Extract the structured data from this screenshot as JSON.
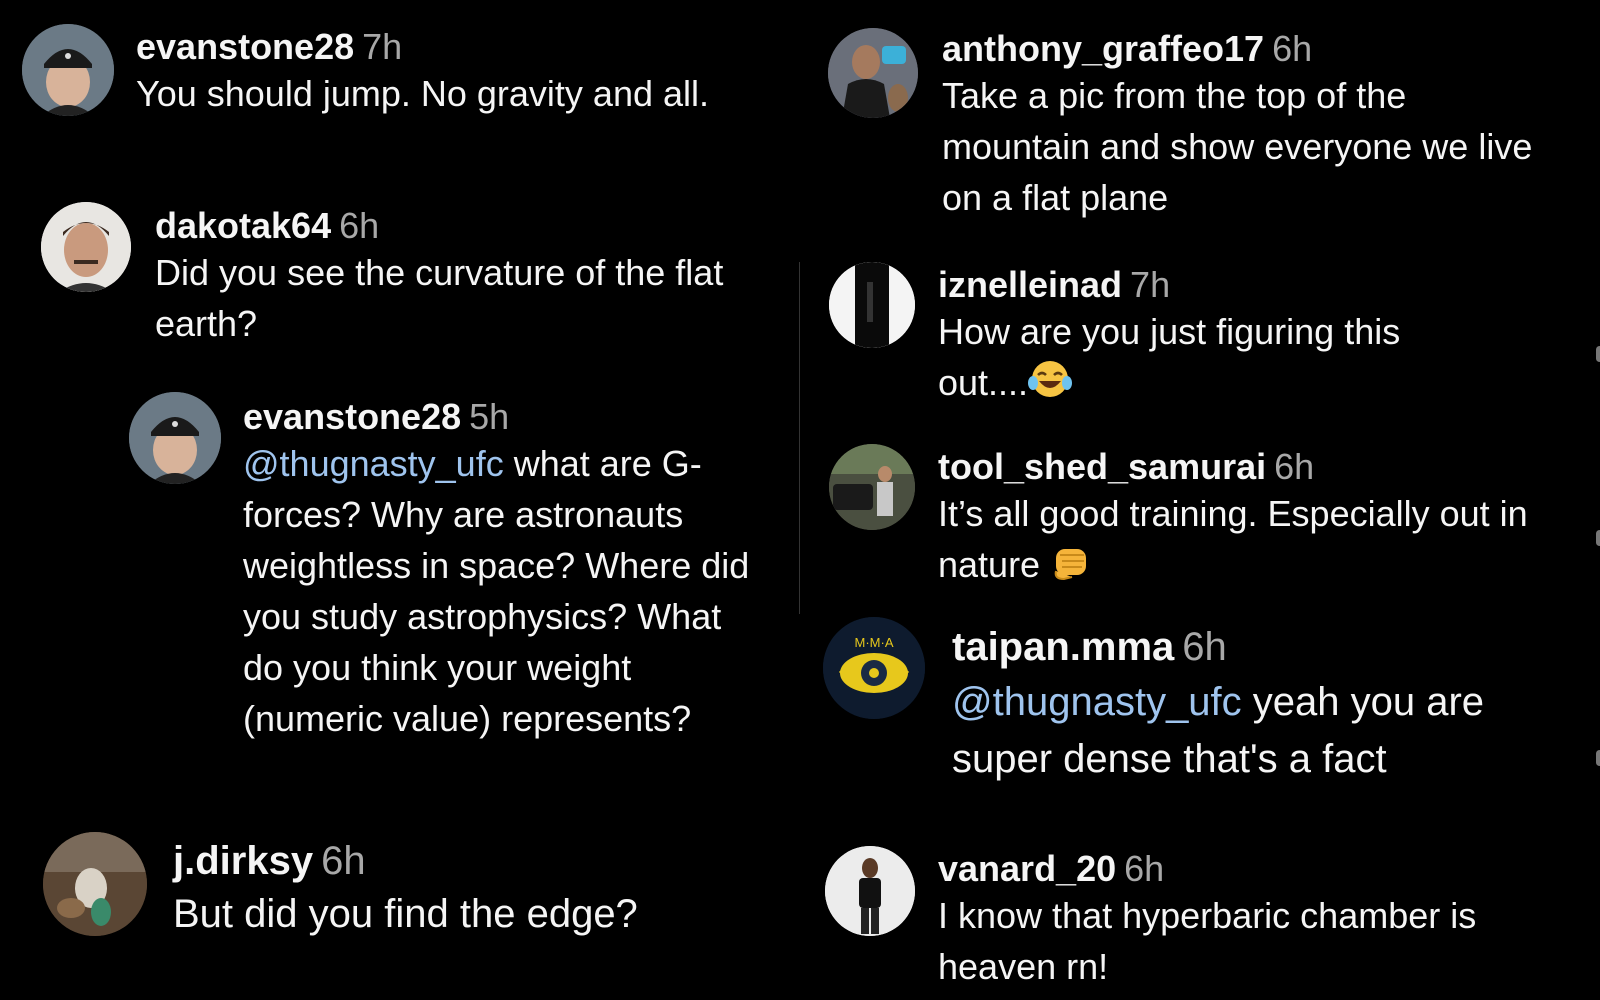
{
  "colors": {
    "background": "#000000",
    "text": "#f5f5f5",
    "timestamp": "#a8a8a8",
    "mention": "#9fc4ee"
  },
  "comments": [
    {
      "username": "evanstone28",
      "time": "7h",
      "text": "You should jump. No gravity and all."
    },
    {
      "username": "dakotak64",
      "time": "6h",
      "text": "Did you see the curvature of the flat earth?"
    },
    {
      "username": "evanstone28",
      "time": "5h",
      "mention": "@thugnasty_ufc",
      "text": " what are G-forces? Why are astronauts weightless in space? Where did you study astrophysics? What do you think your weight (numeric value) represents?"
    },
    {
      "username": "j.dirksy",
      "time": "6h",
      "text": "But did you find the edge?"
    },
    {
      "username": "anthony_graffeo17",
      "time": "6h",
      "text": "Take a pic from the top of the mountain and show everyone we live on a flat plane"
    },
    {
      "username": "iznelleinad",
      "time": "7h",
      "text": "How are you just figuring this out....",
      "emoji": "laughing-tears-emoji"
    },
    {
      "username": "tool_shed_samurai",
      "time": "6h",
      "text": "It’s all good training. Especially out in nature ",
      "emoji": "fist-bump-emoji"
    },
    {
      "username": "taipan.mma",
      "time": "6h",
      "mention": "@thugnasty_ufc",
      "text": " yeah you are super dense that's a fact",
      "avatar_text": "M·M·A"
    },
    {
      "username": "vanard_20",
      "time": "6h",
      "text": "I know that hyperbaric chamber is heaven rn!"
    }
  ]
}
